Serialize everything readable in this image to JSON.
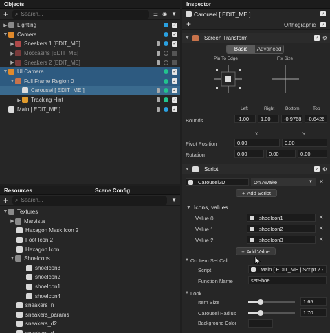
{
  "objects": {
    "title": "Objects",
    "search_placeholder": "Search...",
    "rows": [
      {
        "label": "Lighting",
        "icon": "folder-icon"
      },
      {
        "label": "Camera",
        "icon": "camera-icon"
      },
      {
        "label": "Sneakers 1 [EDIT_ME]",
        "icon": "image-icon"
      },
      {
        "label": "Moccasins [EDIT_ME]",
        "icon": "image-icon"
      },
      {
        "label": "Sneakers 2 [EDIT_ME]",
        "icon": "image-icon"
      },
      {
        "label": "UI Camera",
        "icon": "camera-icon"
      },
      {
        "label": "Full Frame Region 0",
        "icon": "frame-icon"
      },
      {
        "label": "Carousel [ EDIT_ME ]",
        "icon": "document-icon"
      },
      {
        "label": "Tracking Hint",
        "icon": "tracking-icon"
      },
      {
        "label": "Main [ EDIT_ME ]",
        "icon": "document-icon"
      }
    ]
  },
  "resources": {
    "tab_resources": "Resources",
    "tab_scene_config": "Scene Config",
    "search_placeholder": "Search...",
    "rows": [
      {
        "label": "Textures"
      },
      {
        "label": "Marvista"
      },
      {
        "label": "Hexagon Mask Icon 2"
      },
      {
        "label": "Foot Icon 2"
      },
      {
        "label": "Hexagon Icon"
      },
      {
        "label": "ShoeIcons"
      },
      {
        "label": "shoeIcon3"
      },
      {
        "label": "shoeIcon2"
      },
      {
        "label": "shoeIcon1"
      },
      {
        "label": "shoeIcon4"
      },
      {
        "label": "sneakers_n"
      },
      {
        "label": "sneakers_params"
      },
      {
        "label": "sneakers_d2"
      },
      {
        "label": "sneakers_d"
      }
    ]
  },
  "inspector": {
    "title": "Inspector",
    "object_name": "Carousel [ EDIT_ME ]",
    "orthographic_label": "Orthographic",
    "screen_transform": {
      "title": "Screen Transform",
      "tab_basic": "Basic",
      "tab_advanced": "Advanced",
      "pin_label": "Pin To Edge",
      "fix_label": "Fix Size",
      "bounds_label": "Bounds",
      "col_left": "Left",
      "col_right": "Right",
      "col_bottom": "Bottom",
      "col_top": "Top",
      "bounds": [
        "-1.00",
        "1.00",
        "-0.9768",
        "-0.6426"
      ],
      "x_label": "X",
      "y_label": "Y",
      "pivot_label": "Pivot Position",
      "pivot": [
        "0.00",
        "0.00"
      ],
      "rotation_label": "Rotation",
      "rotation": [
        "0.00",
        "0.00",
        "0.00"
      ]
    },
    "script": {
      "title": "Script",
      "script_name": "Carousel2D",
      "event": "On Awake",
      "add_script": "Add Script",
      "icons_label": "Icons, values",
      "values": [
        {
          "label": "Value 0",
          "texture": "shoeIcon1"
        },
        {
          "label": "Value 1",
          "texture": "shoeIcon2"
        },
        {
          "label": "Value 2",
          "texture": "shoeIcon3"
        }
      ],
      "add_value": "Add Value",
      "on_item_label": "On Item Set Call",
      "script_label": "Script",
      "script_ref": "Main [ EDIT_ME ].Script 2 -",
      "function_label": "Function Name",
      "function_value": "setShoe",
      "look_label": "Look",
      "item_size_label": "Item Size",
      "item_size": "1.65",
      "item_size_fraction": 0.26,
      "radius_label": "Carousel Radius",
      "radius": "1.70",
      "radius_fraction": 0.27,
      "bg_color_label": "Background Color"
    }
  }
}
